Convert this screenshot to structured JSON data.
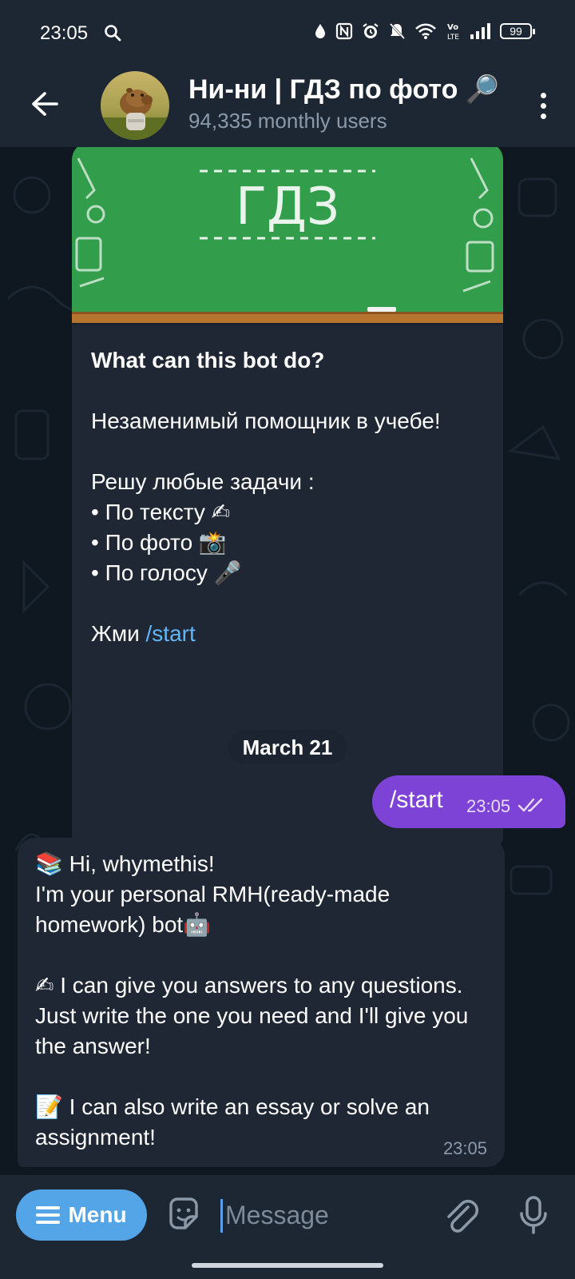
{
  "status_bar": {
    "time": "23:05",
    "battery": "99",
    "icons": [
      "search-icon",
      "drop-icon",
      "nfc-icon",
      "alarm-icon",
      "mute-icon",
      "wifi-icon",
      "volte-icon",
      "signal-icon",
      "battery-icon"
    ]
  },
  "header": {
    "title": "Ни-ни | ГДЗ по фото 🔎",
    "subtitle": "94,335 monthly users"
  },
  "bot_card": {
    "image_text": "ГДЗ",
    "heading": "What can this bot do?",
    "para1": "Незаменимый помощник в учебе!",
    "para2_title": "Решу любые задачи :",
    "items": [
      "• По тексту ✍",
      "• По фото 📸",
      "• По голосу 🎤"
    ],
    "cta_prefix": "Жми ",
    "cta_link": "/start"
  },
  "date_divider": "March 21",
  "outgoing": {
    "text": "/start",
    "time": "23:05"
  },
  "incoming": {
    "line1": "📚 Hi, whymethis!",
    "line2": "I'm your personal RMH(ready-made homework) bot🤖",
    "para2": "✍ I can give you answers to any questions. Just write the one you need and I'll give you the answer!",
    "para3": "📝 I can also write an essay or solve an assignment!",
    "time": "23:05"
  },
  "input_bar": {
    "menu_label": "Menu",
    "placeholder": "Message"
  },
  "colors": {
    "header_bg": "#1d2733",
    "chat_bg": "#0f1720",
    "bubble_in": "#1e2733",
    "bubble_out": "#7d43d6",
    "accent": "#54a4e8",
    "link": "#64b5f6"
  }
}
